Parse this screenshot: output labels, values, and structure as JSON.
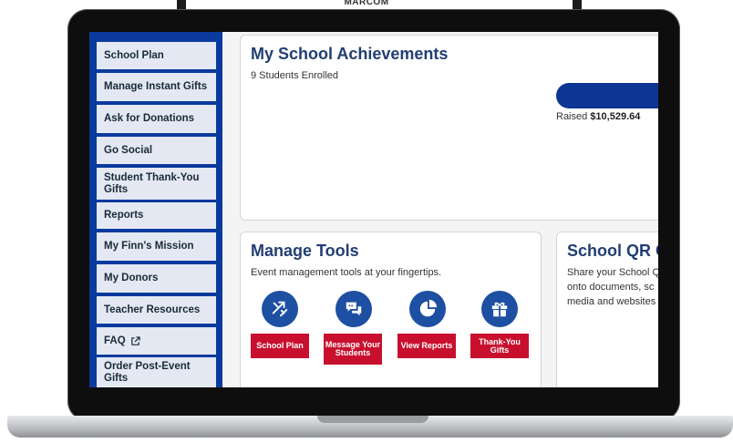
{
  "brand": {
    "logo_text": "MARCOM"
  },
  "sidebar": {
    "items": [
      {
        "label": "School Plan"
      },
      {
        "label": "Manage Instant Gifts"
      },
      {
        "label": "Ask for Donations"
      },
      {
        "label": "Go Social"
      },
      {
        "label": "Student Thank-You Gifts"
      },
      {
        "label": "Reports"
      },
      {
        "label": "My Finn's Mission"
      },
      {
        "label": "My Donors"
      },
      {
        "label": "Teacher Resources"
      },
      {
        "label": "FAQ",
        "icon": "external-link-icon"
      },
      {
        "label": "Order Post-Event Gifts"
      }
    ]
  },
  "achievements": {
    "title": "My School Achievements",
    "enrolled": "9 Students Enrolled",
    "raised_label": "Raised",
    "raised_amount": "$10,529.64"
  },
  "tools": {
    "title": "Manage Tools",
    "subtitle": "Event management tools at your fingertips.",
    "buttons": [
      {
        "label": "School Plan",
        "icon": "shuffle-icon"
      },
      {
        "label": "Message Your Students",
        "icon": "chat-icon"
      },
      {
        "label": "View Reports",
        "icon": "pie-chart-icon"
      },
      {
        "label": "Thank-You Gifts",
        "icon": "gift-icon"
      }
    ]
  },
  "qr": {
    "title": "School QR C",
    "lines": [
      "Share your School Q",
      "onto documents, sc",
      "media and websites"
    ]
  },
  "colors": {
    "brand_blue": "#0b3a9e",
    "accent_red": "#c8102e",
    "title_blue": "#213e73"
  }
}
